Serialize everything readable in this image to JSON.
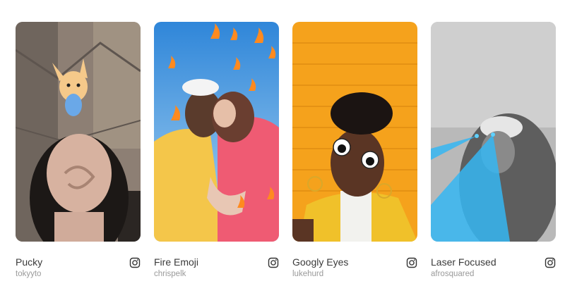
{
  "effects": [
    {
      "title": "Pucky",
      "author": "tokyyto",
      "icon": "instagram-icon"
    },
    {
      "title": "Fire Emoji",
      "author": "chrispelk",
      "icon": "instagram-icon"
    },
    {
      "title": "Googly Eyes",
      "author": "lukehurd",
      "icon": "instagram-icon"
    },
    {
      "title": "Laser Focused",
      "author": "afrosquared",
      "icon": "instagram-icon"
    }
  ]
}
